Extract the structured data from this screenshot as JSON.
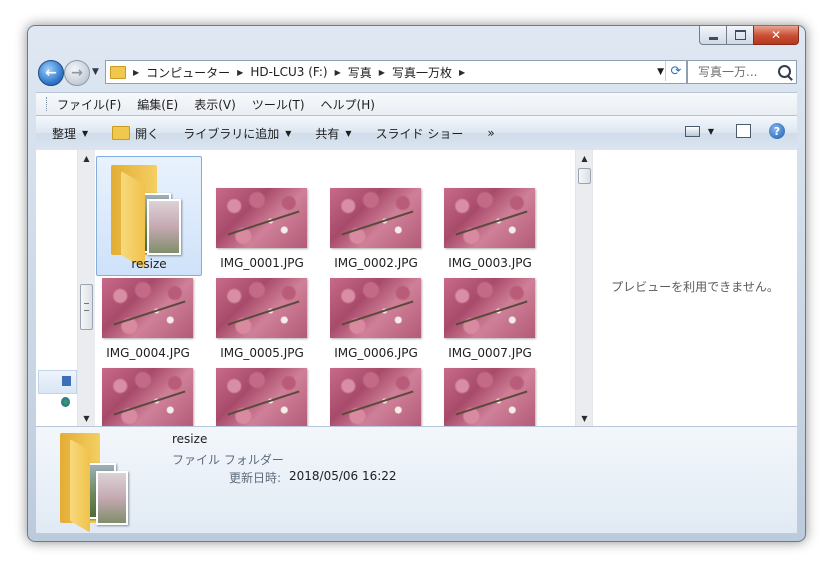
{
  "address": {
    "crumbs": [
      "コンピューター",
      "HD-LCU3 (F:)",
      "写真",
      "写真一万枚"
    ]
  },
  "search": {
    "placeholder": "写真一万..."
  },
  "menu": [
    "ファイル(F)",
    "編集(E)",
    "表示(V)",
    "ツール(T)",
    "ヘルプ(H)"
  ],
  "toolbar": {
    "organize": "整理",
    "open": "開く",
    "library": "ライブラリに追加",
    "share": "共有",
    "slideshow": "スライド ショー",
    "more": "»"
  },
  "files": [
    {
      "name": "resize",
      "kind": "folder"
    },
    {
      "name": "IMG_0001.JPG",
      "kind": "image"
    },
    {
      "name": "IMG_0002.JPG",
      "kind": "image"
    },
    {
      "name": "IMG_0003.JPG",
      "kind": "image"
    },
    {
      "name": "IMG_0004.JPG",
      "kind": "image"
    },
    {
      "name": "IMG_0005.JPG",
      "kind": "image"
    },
    {
      "name": "IMG_0006.JPG",
      "kind": "image"
    },
    {
      "name": "IMG_0007.JPG",
      "kind": "image"
    },
    {
      "name": "",
      "kind": "image"
    },
    {
      "name": "",
      "kind": "image"
    },
    {
      "name": "",
      "kind": "image"
    },
    {
      "name": "",
      "kind": "image"
    }
  ],
  "preview": {
    "message": "プレビューを利用できません。"
  },
  "details": {
    "name": "resize",
    "type": "ファイル フォルダー",
    "date_label": "更新日時:",
    "date_value": "2018/05/06 16:22"
  }
}
